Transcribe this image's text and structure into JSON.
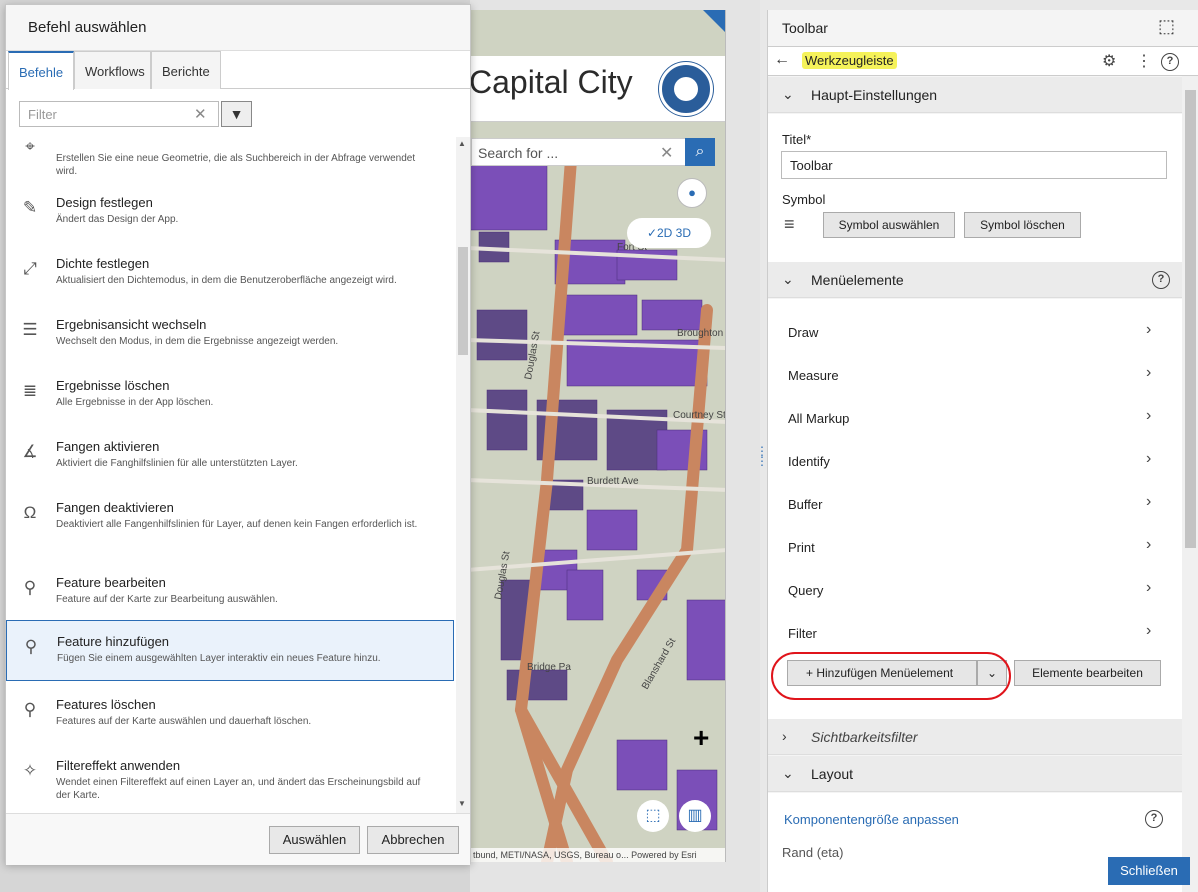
{
  "dialog": {
    "title": "Befehl auswählen",
    "tabs": [
      "Befehle",
      "Workflows",
      "Berichte"
    ],
    "filter_placeholder": "Filter",
    "commands": [
      {
        "icon": "geometry-search-icon",
        "title": "",
        "desc": "Erstellen Sie eine neue Geometrie, die als Suchbereich in der Abfrage verwendet wird."
      },
      {
        "icon": "design-icon",
        "title": "Design festlegen",
        "desc": "Ändert das Design der App."
      },
      {
        "icon": "density-icon",
        "title": "Dichte festlegen",
        "desc": "Aktualisiert den Dichtemodus, in dem die Benutzeroberfläche angezeigt wird."
      },
      {
        "icon": "results-view-icon",
        "title": "Ergebnisansicht wechseln",
        "desc": "Wechselt den Modus, in dem die Ergebnisse angezeigt werden."
      },
      {
        "icon": "clear-results-icon",
        "title": "Ergebnisse löschen",
        "desc": "Alle Ergebnisse in der App löschen."
      },
      {
        "icon": "snapping-on-icon",
        "title": "Fangen aktivieren",
        "desc": "Aktiviert die Fanghilfslinien für alle unterstützten Layer."
      },
      {
        "icon": "snapping-off-icon",
        "title": "Fangen deaktivieren",
        "desc": "Deaktiviert alle Fangenhilfslinien für Layer, auf denen kein Fangen erforderlich ist."
      },
      {
        "icon": "edit-feature-icon",
        "title": "Feature bearbeiten",
        "desc": "Feature auf der Karte zur Bearbeitung auswählen."
      },
      {
        "icon": "add-feature-icon",
        "title": "Feature hinzufügen",
        "desc": "Fügen Sie einem ausgewählten Layer interaktiv ein neues Feature hinzu."
      },
      {
        "icon": "delete-feature-icon",
        "title": "Features löschen",
        "desc": "Features auf der Karte auswählen und dauerhaft löschen."
      },
      {
        "icon": "filter-effect-icon",
        "title": "Filtereffekt anwenden",
        "desc": "Wendet einen Filtereffekt auf einen Layer an, und ändert das Erscheinungsbild auf der Karte."
      }
    ],
    "select_label": "Auswählen",
    "cancel_label": "Abbrechen"
  },
  "map": {
    "title": "Capital City",
    "search_placeholder": "Search for ...",
    "view_toggle": "✓2D 3D",
    "attribution": "tbund, METI/NASA, USGS, Bureau o...   Powered by Esri",
    "streets": [
      "Fort St",
      "Douglas St",
      "Broughton",
      "Courtney St",
      "Burdett Ave",
      "Blanshard St",
      "Douglas St",
      "Bridge Pa"
    ]
  },
  "panel": {
    "header_title": "Toolbar",
    "breadcrumb": "Werkzeugleiste",
    "main_settings": {
      "title": "Haupt-Einstellungen",
      "title_label": "Titel*",
      "title_value": "Toolbar",
      "symbol_label": "Symbol",
      "select_symbol": "Symbol auswählen",
      "delete_symbol": "Symbol löschen"
    },
    "menu_items": {
      "title": "Menüelemente",
      "items": [
        "Draw",
        "Measure",
        "All Markup",
        "Identify",
        "Buffer",
        "Print",
        "Query",
        "Filter"
      ],
      "add_label": "+ Hinzufügen Menüelement",
      "edit_label": "Elemente bearbeiten"
    },
    "visibility_filter": "Sichtbarkeitsfilter",
    "layout": {
      "title": "Layout",
      "resize_link": "Komponentengröße anpassen",
      "cut_label": "Rand (eta)"
    },
    "close_label": "Schließen"
  }
}
